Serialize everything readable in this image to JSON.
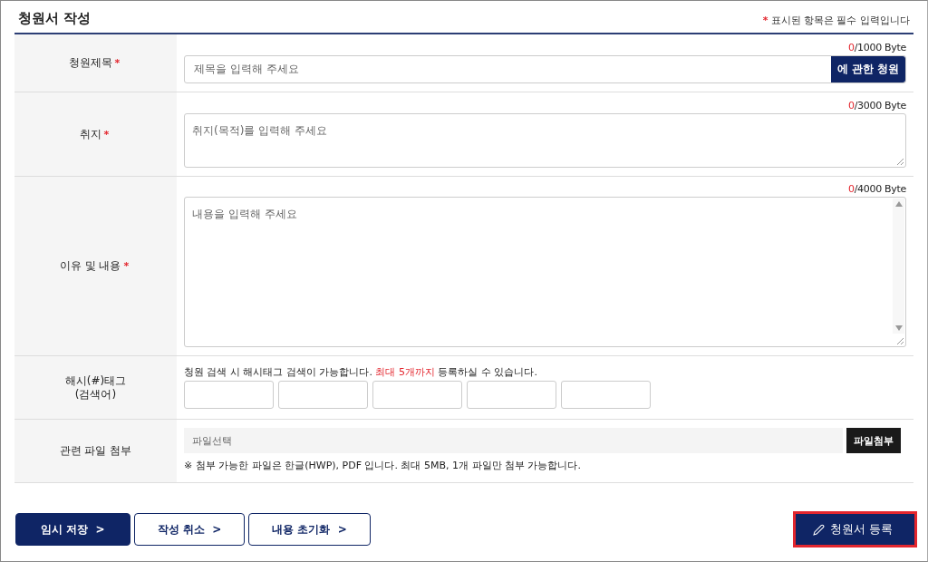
{
  "header": {
    "title": "청원서 작성",
    "required_mark": "*",
    "required_note": "표시된 항목은 필수 입력입니다"
  },
  "fields": [
    {
      "kind": "input",
      "label": "청원제목",
      "required_mark": "*",
      "count": "0",
      "limit": "/1000 Byte",
      "placeholder": "제목을 입력해 주세요",
      "suffix_button": "에 관한 청원"
    },
    {
      "kind": "textarea",
      "label": "취지",
      "required_mark": "*",
      "count": "0",
      "limit": "/3000 Byte",
      "placeholder": "취지(목적)를 입력해 주세요",
      "scrollbar": false
    },
    {
      "kind": "textarea",
      "label": "이유 및 내용",
      "required_mark": "*",
      "count": "0",
      "limit": "/4000 Byte",
      "placeholder": "내용을 입력해 주세요",
      "scrollbar": true
    },
    {
      "kind": "tags",
      "label": "해시(#)태그\n(검색어)",
      "hint": [
        {
          "text": "청원 검색 시 해시태그 검색이 가능합니다. ",
          "highlight": false
        },
        {
          "text": "최대 5개까지",
          "highlight": true
        },
        {
          "text": " 등록하실 수 있습니다.",
          "highlight": false
        }
      ]
    },
    {
      "kind": "file",
      "label": "관련 파일 첨부",
      "placeholder": "파일선택",
      "button": "파일첨부",
      "note": "※ 첨부 가능한 파일은 한글(HWP), PDF 입니다. 최대 5MB, 1개 파일만 첨부 가능합니다."
    }
  ],
  "actions": [
    {
      "label": "임시 저장  >",
      "primary": true
    },
    {
      "label": "작성 취소  >",
      "primary": false
    },
    {
      "label": "내용 초기화  >",
      "primary": false
    }
  ],
  "submit": {
    "label": "청원서 등록",
    "focused": true
  }
}
